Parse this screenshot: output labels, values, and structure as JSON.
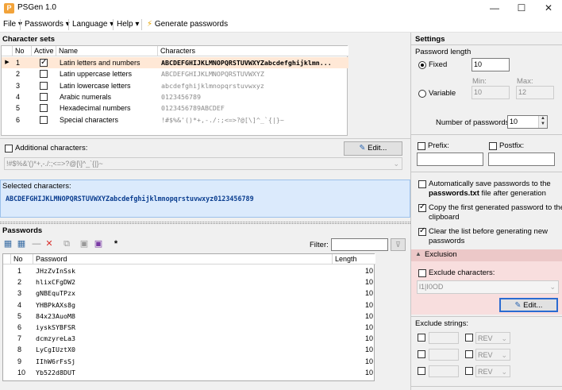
{
  "window": {
    "title": "PSGen 1.0"
  },
  "menu": {
    "file": "File",
    "passwords": "Passwords",
    "language": "Language",
    "help": "Help",
    "generate": "Generate passwords"
  },
  "charsets": {
    "header": "Character sets",
    "columns": [
      "No",
      "Active",
      "Name",
      "Characters"
    ],
    "rows": [
      {
        "no": "1",
        "active": true,
        "name": "Latin letters and numbers",
        "chars": "ABCDEFGHIJKLMNOPQRSTUVWXYZabcdefghijklmn..."
      },
      {
        "no": "2",
        "active": false,
        "name": "Latin uppercase letters",
        "chars": "ABCDEFGHIJKLMNOPQRSTUVWXYZ"
      },
      {
        "no": "3",
        "active": false,
        "name": "Latin lowercase letters",
        "chars": "abcdefghijklmnopqrstuvwxyz"
      },
      {
        "no": "4",
        "active": false,
        "name": "Arabic numerals",
        "chars": "0123456789"
      },
      {
        "no": "5",
        "active": false,
        "name": "Hexadecimal numbers",
        "chars": "0123456789ABCDEF"
      },
      {
        "no": "6",
        "active": false,
        "name": "Special characters",
        "chars": "!#$%&'()*+,-./:;<=>?@[\\]^_`{|}~"
      }
    ],
    "additional_label": "Additional characters:",
    "edit_label": "Edit...",
    "additional_value": "!#$%&'()*+,-./:;<=>?@[\\]^_`{|}~"
  },
  "selected": {
    "label": "Selected characters:",
    "value": "ABCDEFGHIJKLMNOPQRSTUVWXYZabcdefghijklmnopqrstuvwxyz0123456789"
  },
  "passwords": {
    "header": "Passwords",
    "filter_label": "Filter:",
    "columns": [
      "No",
      "Password",
      "Length"
    ],
    "rows": [
      {
        "no": "1",
        "pw": "JHzZvInSsk",
        "len": "10"
      },
      {
        "no": "2",
        "pw": "hlixCFgDW2",
        "len": "10"
      },
      {
        "no": "3",
        "pw": "gNBEquTPzx",
        "len": "10"
      },
      {
        "no": "4",
        "pw": "YHBPkAXs8g",
        "len": "10"
      },
      {
        "no": "5",
        "pw": "84x23AuoM8",
        "len": "10"
      },
      {
        "no": "6",
        "pw": "iyskSYBFSR",
        "len": "10"
      },
      {
        "no": "7",
        "pw": "dcmzyreLa3",
        "len": "10"
      },
      {
        "no": "8",
        "pw": "LyCgIUztX0",
        "len": "10"
      },
      {
        "no": "9",
        "pw": "IIhW6rFsSj",
        "len": "10"
      },
      {
        "no": "10",
        "pw": "Yb522d8DUT",
        "len": "10"
      }
    ]
  },
  "settings": {
    "header": "Settings",
    "pw_length": "Password length",
    "fixed": "Fixed",
    "fixed_value": "10",
    "variable": "Variable",
    "min_label": "Min:",
    "max_label": "Max:",
    "min_value": "10",
    "max_value": "12",
    "num_label": "Number of passwords:",
    "num_value": "10",
    "prefix": "Prefix:",
    "postfix": "Postfix:",
    "autosave_1": "Automatically save passwords to the",
    "autosave_file": "passwords.txt",
    "autosave_2": " file after generation",
    "copy_1": "Copy the first generated password to the",
    "copy_2": "clipboard",
    "clear_1": "Clear the list before generating new",
    "clear_2": "passwords"
  },
  "exclusion": {
    "header": "Exclusion",
    "exclude_chars": "Exclude characters:",
    "exclude_value": "l1|I0OD",
    "edit_label": "Edit...",
    "strings_label": "Exclude strings:",
    "rev": "REV"
  },
  "colors": {
    "accent": "#0a246a",
    "selected_row": "#ffe8d6",
    "selected_box": "#dbeafc",
    "exclusion_bg": "#f8dede"
  }
}
